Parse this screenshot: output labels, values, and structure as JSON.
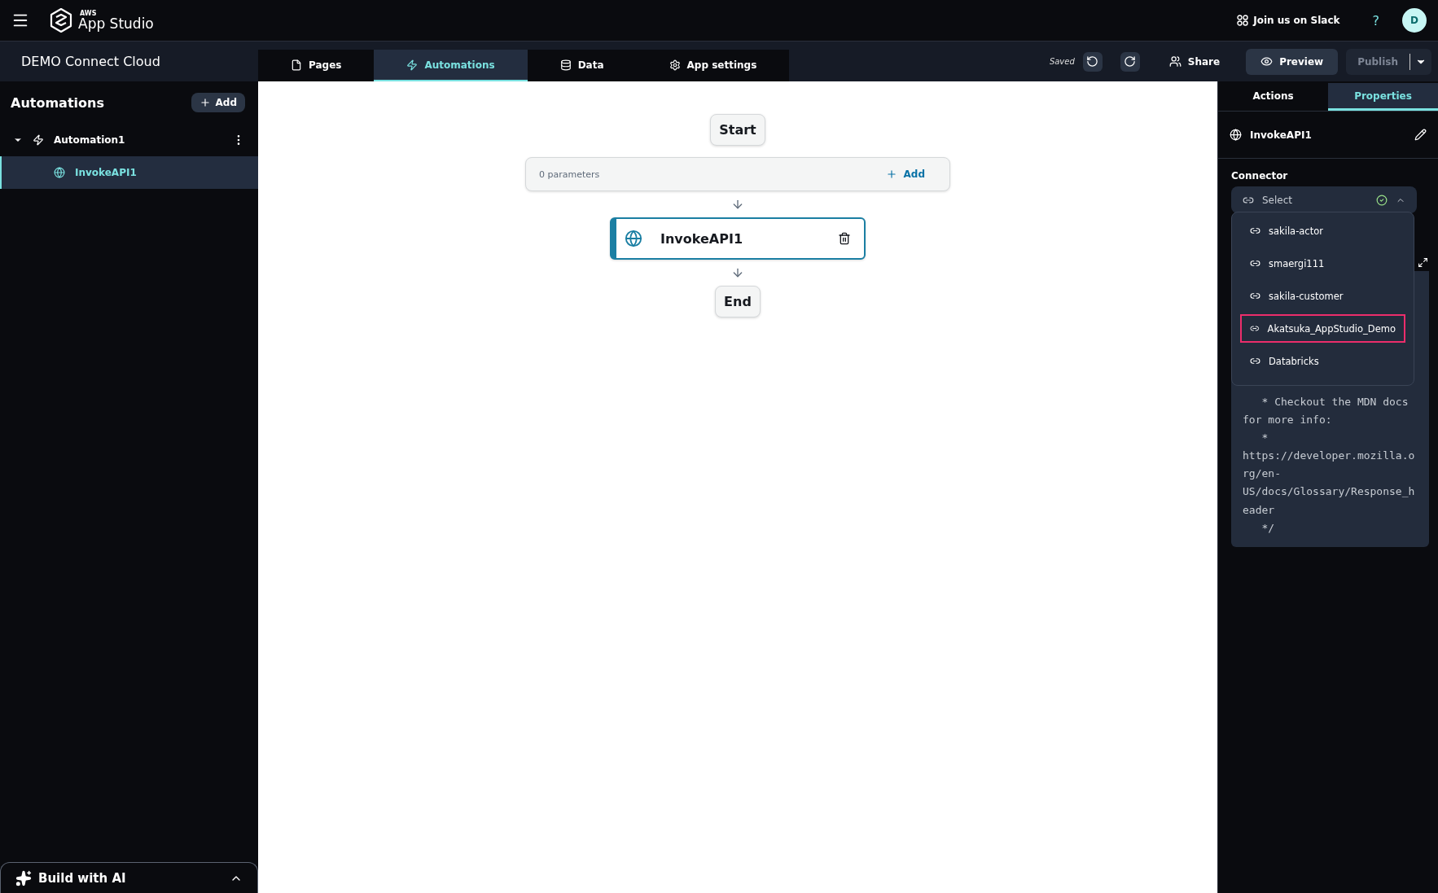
{
  "app_bar": {
    "logo_small": "AWS",
    "logo_name": "App Studio",
    "slack_link": "Join us on Slack",
    "help": "?",
    "avatar": "D"
  },
  "project_bar": {
    "app_name": "DEMO Connect Cloud",
    "tabs": [
      {
        "label": "Pages",
        "selected": false
      },
      {
        "label": "Automations",
        "selected": true
      },
      {
        "label": "Data",
        "selected": false
      },
      {
        "label": "App settings",
        "selected": false
      }
    ],
    "save_status": "Saved",
    "share": "Share",
    "preview": "Preview",
    "publish": {
      "label": "Publish",
      "disabled": true
    }
  },
  "sidebar": {
    "title": "Automations",
    "add": "Add",
    "tree": [
      {
        "label": "Automation1",
        "expanded": true,
        "selected": false,
        "children": [
          {
            "label": "InvokeAPI1",
            "selected": true
          }
        ]
      }
    ],
    "build_ai": "Build with AI"
  },
  "canvas": {
    "start": "Start",
    "parameters": {
      "count": "0 parameters",
      "add": "Add"
    },
    "steps": [
      {
        "label": "InvokeAPI1",
        "selected": true
      }
    ],
    "end": "End"
  },
  "properties_panel": {
    "tabs": [
      {
        "label": "Actions",
        "selected": false
      },
      {
        "label": "Properties",
        "selected": true
      }
    ],
    "header": "InvokeAPI1",
    "connector": {
      "label": "Connector",
      "placeholder": "Select",
      "expanded": true,
      "options": [
        {
          "label": "sakila-actor",
          "selected": false
        },
        {
          "label": "smaergi111",
          "selected": false
        },
        {
          "label": "sakila-customer",
          "selected": false
        },
        {
          "label": "Akatsuka_AppStudio_Demo",
          "selected": true
        },
        {
          "label": "Databricks",
          "selected": false
        }
      ]
    },
    "code_lines": [
      "   * Checkout the MDN docs",
      "for more info:",
      "   *",
      "https://developer.mozilla.org/en-US/docs/Glossary/Response_header",
      "   */"
    ]
  }
}
